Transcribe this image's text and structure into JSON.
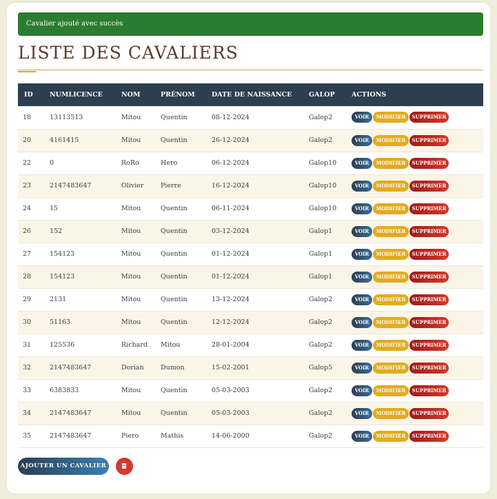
{
  "alert": {
    "message": "Cavalier ajouté avec succès",
    "color": "#2a7d2e"
  },
  "page_title": "LISTE DES CAVALIERS",
  "table": {
    "headers": [
      "ID",
      "NUMLICENCE",
      "NOM",
      "PRÉNOM",
      "DATE DE NAISSANCE",
      "GALOP",
      "ACTIONS"
    ],
    "rows": [
      [
        "18",
        "13113513",
        "Mitou",
        "Quentin",
        "08-12-2024",
        "Galop2"
      ],
      [
        "20",
        "4161415",
        "Mitou",
        "Quentin",
        "26-12-2024",
        "Galop2"
      ],
      [
        "22",
        "0",
        "RoRo",
        "Hero",
        "06-12-2024",
        "Galop10"
      ],
      [
        "23",
        "2147483647",
        "Olivier",
        "Pierre",
        "16-12-2024",
        "Galop10"
      ],
      [
        "24",
        "15",
        "Mitou",
        "Quentin",
        "06-11-2024",
        "Galop10"
      ],
      [
        "26",
        "152",
        "Mitou",
        "Quentin",
        "03-12-2024",
        "Galop1"
      ],
      [
        "27",
        "154123",
        "Mitou",
        "Quentin",
        "01-12-2024",
        "Galop1"
      ],
      [
        "28",
        "154123",
        "Mitou",
        "Quentin",
        "01-12-2024",
        "Galop1"
      ],
      [
        "29",
        "2131",
        "Mitou",
        "Quentin",
        "13-12-2024",
        "Galop2"
      ],
      [
        "30",
        "51163",
        "Mitou",
        "Quentin",
        "12-12-2024",
        "Galop2"
      ],
      [
        "31",
        "125536",
        "Richard",
        "Mitou",
        "28-01-2004",
        "Galop2"
      ],
      [
        "32",
        "2147483647",
        "Dorian",
        "Dumon",
        "15-02-2001",
        "Galop5"
      ],
      [
        "33",
        "6383833",
        "Mitou",
        "Quentin",
        "05-03-2003",
        "Galop2"
      ],
      [
        "34",
        "2147483647",
        "Mitou",
        "Quentin",
        "05-03-2003",
        "Galop2"
      ],
      [
        "35",
        "2147483647",
        "Piero",
        "Mathis",
        "14-06-2000",
        "Galop2"
      ]
    ],
    "actions": {
      "view": "VOIR",
      "edit": "MODIFIER",
      "delete": "SUPPRIMER"
    }
  },
  "footer": {
    "add_label": "AJOUTER UN CAVALIER",
    "pdf_icon": "pdf-icon"
  },
  "colors": {
    "header_bg": "#2c3e50",
    "accent_gold": "#c9a54b",
    "edit_yellow": "#e3ab1d",
    "delete_red": "#c0221c",
    "title_brown": "#5b3a2d"
  }
}
